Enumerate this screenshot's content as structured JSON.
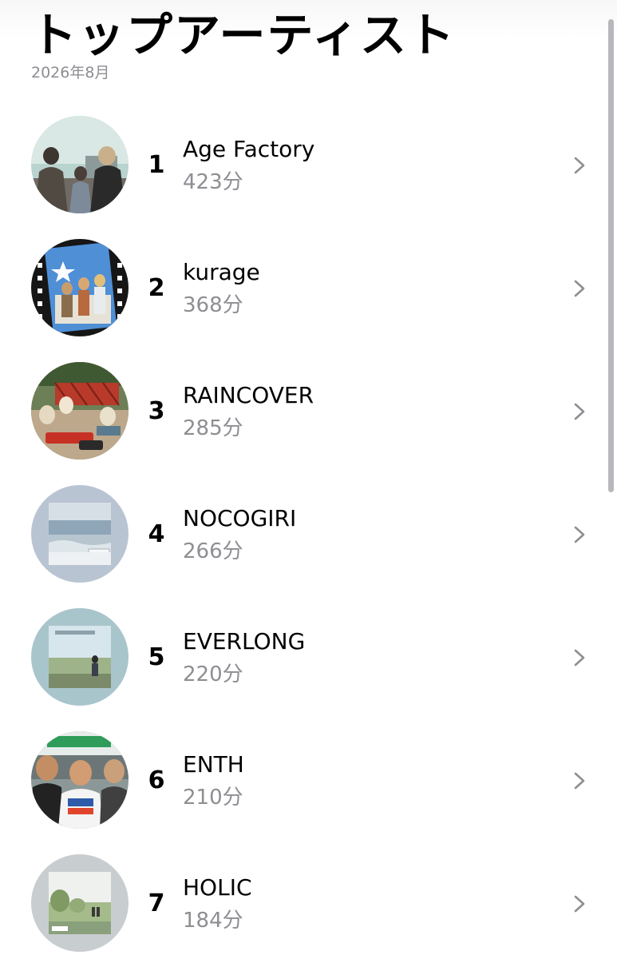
{
  "header": {
    "title": "トップアーティスト",
    "subtitle": "2026年8月"
  },
  "artists": [
    {
      "rank": "1",
      "name": "Age Factory",
      "minutes": "423分",
      "art": "band-photo-icon"
    },
    {
      "rank": "2",
      "name": "kurage",
      "minutes": "368分",
      "art": "film-strip-photo-icon"
    },
    {
      "rank": "3",
      "name": "RAINCOVER",
      "minutes": "285分",
      "art": "toy-train-photo-icon"
    },
    {
      "rank": "4",
      "name": "NOCOGIRI",
      "minutes": "266分",
      "art": "sea-album-icon"
    },
    {
      "rank": "5",
      "name": "EVERLONG",
      "minutes": "220分",
      "art": "field-album-icon"
    },
    {
      "rank": "6",
      "name": "ENTH",
      "minutes": "210分",
      "art": "band-station-photo-icon"
    },
    {
      "rank": "7",
      "name": "HOLIC",
      "minutes": "184分",
      "art": "green-album-icon"
    }
  ]
}
